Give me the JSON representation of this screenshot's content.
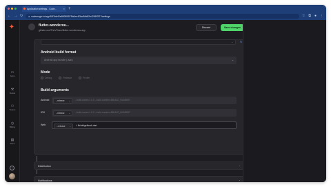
{
  "browser": {
    "tab_title": "Application settings - Code...",
    "url": "codemagic.io/app/62f1bfef2e65080f575b0ee4f3ad9/b6f2e4296f7f27/settings",
    "colors": {
      "chrome": "#1d3e77",
      "accent": "#4fd469"
    }
  },
  "rail": {
    "items": [
      {
        "icon": "window-icon",
        "label": "Apps"
      },
      {
        "icon": "builds-icon",
        "label": "Builds"
      },
      {
        "icon": "teams-icon",
        "label": "Teams"
      },
      {
        "icon": "billing-icon",
        "label": "Billing"
      },
      {
        "icon": "docs-icon",
        "label": "Docs"
      }
    ],
    "help": "?"
  },
  "header": {
    "project_name": "flutter-wonderou...",
    "repo": "github.com/TheVTeam/flutter-wonderous-app",
    "discard": "Discard",
    "save": "Save changes"
  },
  "android_build_format": {
    "title": "Android build format",
    "value": "Android app bundle (.aab)"
  },
  "mode": {
    "title": "Mode",
    "options": [
      "Debug",
      "Release",
      "Profile"
    ]
  },
  "build_arguments": {
    "title": "Build arguments",
    "rows": [
      {
        "platform": "Android",
        "select": "--release",
        "value": "--build-name=1.0.0 --build-number=$BUILD_NUMBER"
      },
      {
        "platform": "iOS",
        "select": "--release",
        "value": "--build-name=1.0.0 --build-number=$BUILD_NUMBER"
      },
      {
        "platform": "Web",
        "select": "--release",
        "value": "-t lib/widgetbook.dart"
      }
    ]
  },
  "sections": {
    "distribution": "Distribution",
    "notifications": "Notifications"
  }
}
